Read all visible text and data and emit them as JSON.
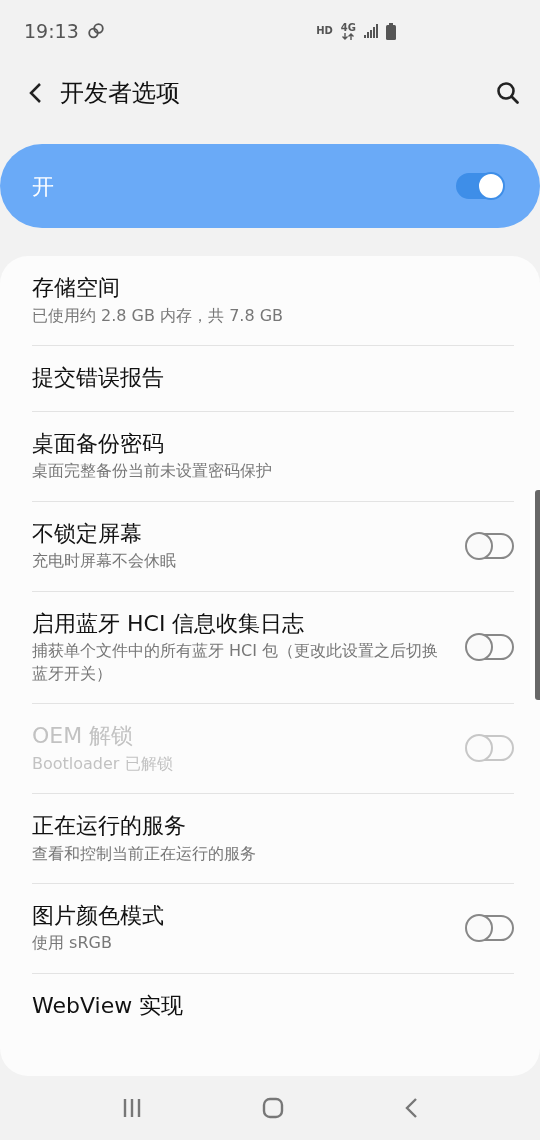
{
  "status_bar": {
    "time": "19:13",
    "hd": "HD",
    "network": "4G"
  },
  "header": {
    "title": "开发者选项"
  },
  "master_switch": {
    "label": "开",
    "on": true
  },
  "items": [
    {
      "kind": "info",
      "title": "存储空间",
      "subtitle": "已使用约 2.8 GB 内存，共 7.8 GB",
      "disabled": false
    },
    {
      "kind": "info",
      "title": "提交错误报告",
      "disabled": false
    },
    {
      "kind": "info",
      "title": "桌面备份密码",
      "subtitle": "桌面完整备份当前未设置密码保护",
      "disabled": false
    },
    {
      "kind": "toggle",
      "title": "不锁定屏幕",
      "subtitle": "充电时屏幕不会休眠",
      "on": false,
      "disabled": false
    },
    {
      "kind": "toggle",
      "title": "启用蓝牙 HCI 信息收集日志",
      "subtitle": "捕获单个文件中的所有蓝牙 HCI 包（更改此设置之后切换蓝牙开关）",
      "on": false,
      "disabled": false
    },
    {
      "kind": "toggle",
      "title": "OEM 解锁",
      "subtitle": "Bootloader 已解锁",
      "on": false,
      "disabled": true
    },
    {
      "kind": "info",
      "title": "正在运行的服务",
      "subtitle": "查看和控制当前正在运行的服务",
      "disabled": false
    },
    {
      "kind": "toggle",
      "title": "图片颜色模式",
      "subtitle": "使用 sRGB",
      "on": false,
      "disabled": false
    },
    {
      "kind": "info",
      "title": "WebView 实现",
      "disabled": false
    }
  ]
}
